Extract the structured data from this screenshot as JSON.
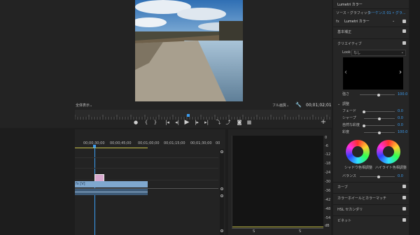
{
  "monitor": {
    "zoom": "全体表示",
    "quality": "フル画質",
    "timecode": "00;01;02;01"
  },
  "timeline": {
    "ruler_labels": [
      "00;00;30;00",
      "00;00;45;00",
      "00;01;00;00",
      "00;01;15;00",
      "00;01;30;00",
      "00"
    ],
    "track_label": "fx [V]"
  },
  "scope": {
    "tick_labels": [
      "0",
      "-6",
      "-12",
      "-18",
      "-24",
      "-30",
      "-36",
      "-42",
      "-48",
      "-54",
      "dB"
    ],
    "bottom_labels": [
      "S",
      "S"
    ]
  },
  "lumetri": {
    "title": "Lumetri カラー",
    "source_label": "ソース・グラフィック",
    "sequence_label": "シーケンス 01 • グラ...",
    "fx_label": "fx",
    "effect_name": "Lumetri カラー",
    "sections": {
      "basic": "基本補正",
      "creative": "クリエイティブ",
      "curves": "カーブ",
      "color_wheels": "カラーホイールとカラーマッチ",
      "hsl": "HSL セカンダリ",
      "vignette": "ビネット"
    },
    "look_label": "Look",
    "look_value": "なし",
    "intensity_label": "強さ",
    "intensity_value": "100.0",
    "adjust_label": "調整",
    "adjustments": [
      {
        "label": "フェード",
        "value": "0.0",
        "level": 0.0
      },
      {
        "label": "シャープ",
        "value": "0.0",
        "level": 0.5
      },
      {
        "label": "自然な彩度",
        "value": "0.0",
        "level": 0.0
      },
      {
        "label": "彩度",
        "value": "100.0",
        "level": 0.5
      }
    ],
    "wheel_labels": [
      "シャドウ色相調整",
      "ハイライト色相調整"
    ],
    "balance_label": "バランス",
    "balance_value": "0.0"
  }
}
